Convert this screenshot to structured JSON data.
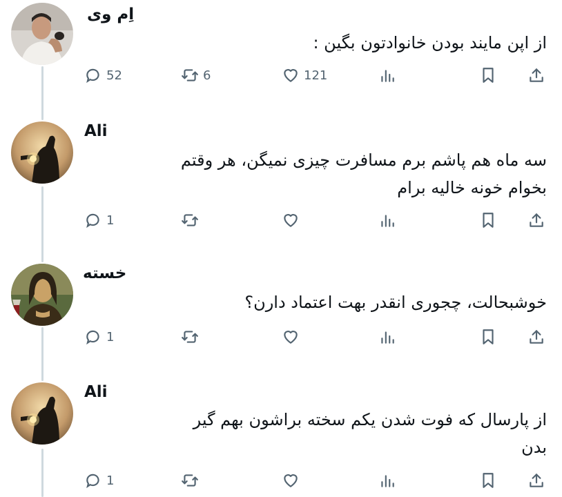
{
  "tweets": [
    {
      "author": "اِم وی",
      "text": "از اپن مایند بودن خانوادتون بگین :",
      "replies": "52",
      "retweets": "6",
      "likes": "121"
    },
    {
      "author": "Ali",
      "text": "سه ماه هم پاشم برم مسافرت چیزی نمیگن، هر وقتم\nبخوام خونه خالیه برام",
      "replies": "1",
      "retweets": "",
      "likes": ""
    },
    {
      "author": "خسته",
      "text": "خوشبحالت، چجوری انقدر بهت اعتماد دارن؟",
      "replies": "1",
      "retweets": "",
      "likes": ""
    },
    {
      "author": "Ali",
      "text": "از پارسال که فوت شدن یکم سخته براشون بهم گیر\nبدن",
      "replies": "1",
      "retweets": "",
      "likes": ""
    }
  ],
  "icons": [
    "reply-icon",
    "retweet-icon",
    "like-icon",
    "views-icon",
    "bookmark-icon",
    "share-icon"
  ],
  "colors": {
    "text": "#0f1419",
    "muted": "#536471",
    "thread_line": "#cfd9de"
  }
}
